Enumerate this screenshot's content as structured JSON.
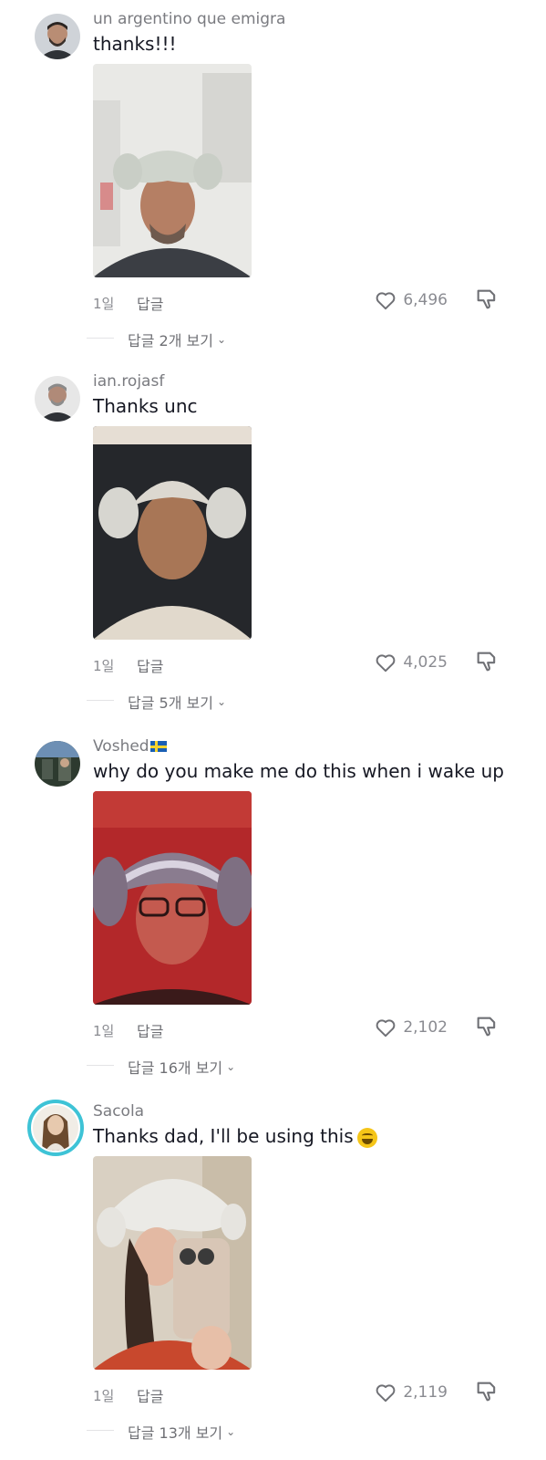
{
  "comments": [
    {
      "username": "un argentino que emigra",
      "text": "thanks!!!",
      "time": "1일",
      "reply_label": "답글",
      "likes": "6,496",
      "view_replies": "답글 2개 보기"
    },
    {
      "username": "ian.rojasf",
      "text": "Thanks unc",
      "time": "1일",
      "reply_label": "답글",
      "likes": "4,025",
      "view_replies": "답글 5개 보기"
    },
    {
      "username": "Voshed",
      "text": "why do you make me do this when i wake up",
      "time": "1일",
      "reply_label": "답글",
      "likes": "2,102",
      "view_replies": "답글 16개 보기"
    },
    {
      "username": "Sacola",
      "text": "Thanks dad, I'll be using this",
      "time": "1일",
      "reply_label": "답글",
      "likes": "2,119",
      "view_replies": "답글 13개 보기"
    }
  ],
  "icons": {
    "like": "heart-outline-icon",
    "dislike": "thumbs-down-icon",
    "expand": "chevron-down-icon",
    "flag": "sweden-flag-icon",
    "emoji": "grinning-squinting-face-icon"
  },
  "colors": {
    "username": "#7a7b80",
    "text": "#161823",
    "meta": "#8a8b91",
    "story_ring": "#3ec3d6"
  }
}
